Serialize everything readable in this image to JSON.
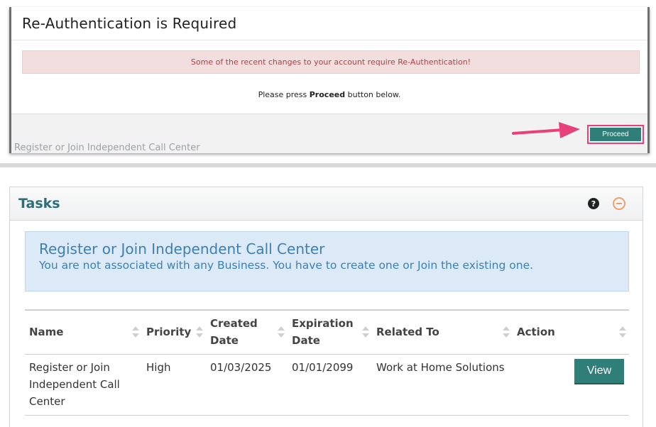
{
  "modal": {
    "title": "Re-Authentication is Required",
    "alert": "Some of the recent changes to your account require Re-Authentication!",
    "message_prefix": "Please press",
    "message_bold": "Proceed",
    "message_suffix": "button below.",
    "proceed_label": "Proceed",
    "behind_text": "Register or Join Independent Call Center"
  },
  "tasks": {
    "title": "Tasks",
    "help_icon": "?",
    "info_title": "Register or Join Independent Call Center",
    "info_text": "You are not associated with any Business. You have to create one or Join the existing one.",
    "columns": [
      "Name",
      "Priority",
      "Created Date",
      "Expiration Date",
      "Related To",
      "Action"
    ],
    "rows": [
      {
        "name": "Register or Join Independent Call Center",
        "priority": "High",
        "created": "01/03/2025",
        "expiration": "01/01/2099",
        "related": "Work at Home Solutions",
        "action": "View"
      }
    ]
  },
  "colors": {
    "accent": "#2f7e78",
    "highlight": "#e8407a",
    "alert_bg": "#f2dede",
    "info_bg": "#dbeaf6"
  },
  "icons": [
    "help-icon",
    "collapse-icon",
    "sort-icon",
    "arrow-icon"
  ]
}
